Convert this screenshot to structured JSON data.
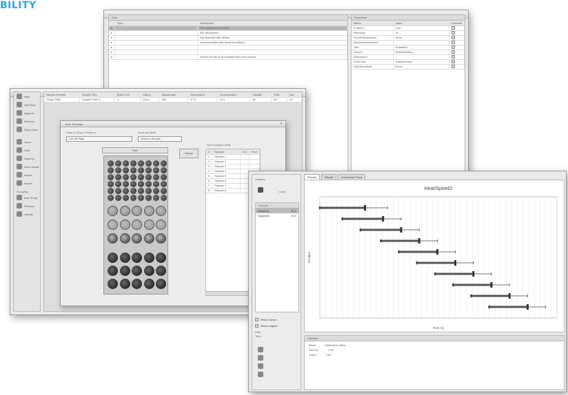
{
  "brand": {
    "text": "BILITY",
    "color": "#2aa7df"
  },
  "win1": {
    "title": "Data",
    "table_headers": [
      "Type",
      "Description"
    ],
    "rows": [
      [
        "",
        "File selected in Explorer"
      ],
      [
        "",
        "File description"
      ],
      [
        "",
        "Not selected with details"
      ],
      [
        "",
        "Not associated with related positions"
      ],
      [
        "",
        ""
      ],
      [
        "",
        ""
      ],
      [
        "",
        "Shows the list of all available files and options"
      ]
    ],
    "props_title": "Properties",
    "props_headers": [
      "Name",
      "Value",
      "Override"
    ],
    "props_rows": [
      [
        "Enabled",
        "True"
      ],
      [
        "Readonly",
        "on"
      ],
      [
        "ShowHeadersRow",
        "None"
      ],
      [
        "AllowSelectionNone",
        ""
      ],
      [
        "Text",
        "DefaultDe"
      ],
      [
        "Source",
        "DefaultSetting"
      ],
      [
        "Description",
        ""
      ],
      [
        "ForeColor",
        "DataGridView"
      ],
      [
        "SelectionMode",
        "None"
      ]
    ]
  },
  "win2": {
    "title": "Layout",
    "sidebar": {
      "items": [
        "New",
        "Add Row",
        "Append",
        "Remove",
        "Show Data"
      ],
      "items2": [
        "Open",
        "Save",
        "Save As",
        "New Layout",
        "Import",
        "Export"
      ],
      "group_label": "Grouping",
      "group_items": [
        "Add Group",
        "Remove",
        "Update"
      ]
    },
    "grid_headers": [
      "Sample Results",
      "Sample Key",
      "Batch Info",
      "Status",
      "Wavelength",
      "Absorbance",
      "Concentration",
      "Viability",
      "Total",
      "Dev"
    ],
    "grid_row": [
      "Single Plate",
      "Sample Plate 1",
      "0",
      "Done",
      "280",
      "0.75",
      "12.3",
      "98",
      "96",
      "0.2"
    ],
    "dialog": {
      "title": "Plate Template",
      "combo1_label": "Plate to Show / Platform",
      "combo1_value": "Lab 96 Plate",
      "combo2_label": "Show all Wells",
      "combo2_value": "Select a Sample",
      "plate_button": "Plate",
      "arrow_button": "Assign",
      "list_title": "Set of sample wells",
      "list_headers": [
        "#",
        "Sample",
        "Col",
        "Row"
      ],
      "list_rows": [
        "Sample 1",
        "Sample 2",
        "Sample 3",
        "Sample 4",
        "Sample 5",
        "Sample 6",
        "Sample 7",
        "Sample 8"
      ]
    }
  },
  "win3": {
    "sidebar_top": [
      "Analysis",
      "Chart"
    ],
    "tabs": [
      "Results",
      "Report",
      "Customize Chart"
    ],
    "list_header": "Sample",
    "list_items": [
      [
        "SampleA",
        "10.0"
      ],
      [
        "SampleB",
        "20.0"
      ]
    ],
    "bottom_checks": [
      "Show Cursor",
      "Show Legend"
    ],
    "info_lines": [
      "Date",
      "Time"
    ],
    "bottom_panel_header": "Statistics",
    "bottom_rows": [
      [
        "Mean",
        "Reference Value"
      ],
      [
        "Std Dev",
        "0.00"
      ],
      [
        "Count",
        "0.00"
      ]
    ]
  },
  "chart_data": {
    "type": "scatter",
    "title": "Heat/Speed2",
    "xlabel": "Time (s)",
    "ylabel": "Position",
    "series": [
      {
        "values": [
          {
            "y": 10,
            "lo": 0.0,
            "mid": 2.0,
            "hi": 3.0
          },
          {
            "y": 9,
            "lo": 1.0,
            "mid": 2.8,
            "hi": 3.6
          },
          {
            "y": 8,
            "lo": 1.8,
            "mid": 3.6,
            "hi": 4.4
          },
          {
            "y": 7,
            "lo": 2.7,
            "mid": 4.4,
            "hi": 5.2
          },
          {
            "y": 6,
            "lo": 3.5,
            "mid": 5.2,
            "hi": 6.0
          },
          {
            "y": 5,
            "lo": 4.3,
            "mid": 6.0,
            "hi": 6.8
          },
          {
            "y": 4,
            "lo": 5.1,
            "mid": 6.8,
            "hi": 7.6
          },
          {
            "y": 3,
            "lo": 5.9,
            "mid": 7.6,
            "hi": 8.4
          },
          {
            "y": 2,
            "lo": 6.7,
            "mid": 8.4,
            "hi": 9.2
          },
          {
            "y": 1,
            "lo": 7.5,
            "mid": 9.2,
            "hi": 10.0
          }
        ]
      }
    ],
    "xlim": [
      0,
      10.5
    ],
    "ylim": [
      0,
      11
    ],
    "grid": true
  }
}
